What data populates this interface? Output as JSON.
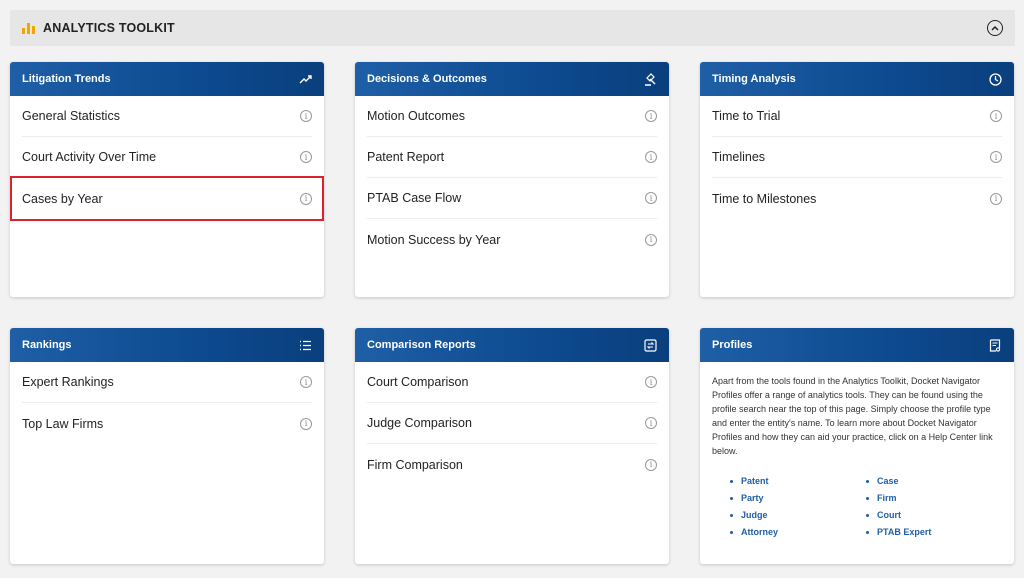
{
  "toolbar": {
    "title": "ANALYTICS TOOLKIT"
  },
  "cards": {
    "litigation": {
      "title": "Litigation Trends",
      "items": [
        "General Statistics",
        "Court Activity Over Time",
        "Cases by Year"
      ]
    },
    "decisions": {
      "title": "Decisions & Outcomes",
      "items": [
        "Motion Outcomes",
        "Patent Report",
        "PTAB Case Flow",
        "Motion Success by Year"
      ]
    },
    "timing": {
      "title": "Timing Analysis",
      "items": [
        "Time to Trial",
        "Timelines",
        "Time to Milestones"
      ]
    },
    "rankings": {
      "title": "Rankings",
      "items": [
        "Expert Rankings",
        "Top Law Firms"
      ]
    },
    "comparison": {
      "title": "Comparison Reports",
      "items": [
        "Court Comparison",
        "Judge Comparison",
        "Firm Comparison"
      ]
    },
    "profiles": {
      "title": "Profiles",
      "text": "Apart from the tools found in the Analytics Toolkit, Docket Navigator Profiles offer a range of analytics tools. They can be found using the profile search near the top of this page. Simply choose the profile type and enter the entity's name. To learn more about Docket Navigator Profiles and how they can aid your practice, click on a Help Center link below.",
      "links": [
        "Patent",
        "Case",
        "Party",
        "Firm",
        "Judge",
        "Court",
        "Attorney",
        "PTAB Expert"
      ]
    }
  },
  "icons": {
    "info": "i"
  },
  "colors": {
    "header_blue": "#0d4a8f",
    "accent_yellow": "#f0a500",
    "highlight_red": "#d9232d"
  }
}
